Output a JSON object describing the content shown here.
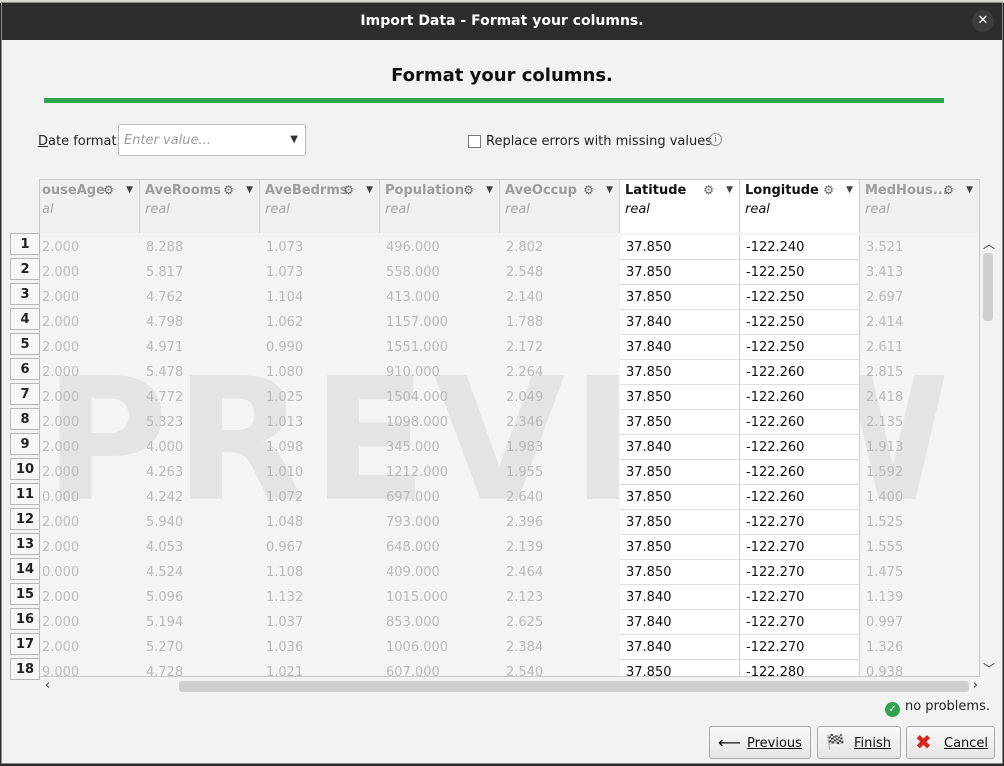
{
  "window": {
    "title": "Import Data - Format your columns.",
    "close_symbol": "✕"
  },
  "heading": "Format your columns.",
  "date_format": {
    "label_prefix": "D",
    "label_rest": "ate format",
    "placeholder": "Enter value..."
  },
  "replace_errors_label": "Replace errors with missing values",
  "watermark": "PREVIEW",
  "columns": [
    {
      "name": "ouseAge",
      "type": "al",
      "active": false
    },
    {
      "name": "AveRooms",
      "type": "real",
      "active": false
    },
    {
      "name": "AveBedrms",
      "type": "real",
      "active": false
    },
    {
      "name": "Population",
      "type": "real",
      "active": false
    },
    {
      "name": "AveOccup",
      "type": "real",
      "active": false
    },
    {
      "name": "Latitude",
      "type": "real",
      "active": true
    },
    {
      "name": "Longitude",
      "type": "real",
      "active": true
    },
    {
      "name": "MedHous...",
      "type": "real",
      "active": false
    }
  ],
  "rows": [
    {
      "n": "1",
      "c": [
        "2.000",
        "8.288",
        "1.073",
        "496.000",
        "2.802",
        "37.850",
        "-122.240",
        "3.521"
      ]
    },
    {
      "n": "2",
      "c": [
        "2.000",
        "5.817",
        "1.073",
        "558.000",
        "2.548",
        "37.850",
        "-122.250",
        "3.413"
      ]
    },
    {
      "n": "3",
      "c": [
        "2.000",
        "4.762",
        "1.104",
        "413.000",
        "2.140",
        "37.850",
        "-122.250",
        "2.697"
      ]
    },
    {
      "n": "4",
      "c": [
        "2.000",
        "4.798",
        "1.062",
        "1157.000",
        "1.788",
        "37.840",
        "-122.250",
        "2.414"
      ]
    },
    {
      "n": "5",
      "c": [
        "2.000",
        "4.971",
        "0.990",
        "1551.000",
        "2.172",
        "37.840",
        "-122.250",
        "2.611"
      ]
    },
    {
      "n": "6",
      "c": [
        "2.000",
        "5.478",
        "1.080",
        "910.000",
        "2.264",
        "37.850",
        "-122.260",
        "2.815"
      ]
    },
    {
      "n": "7",
      "c": [
        "2.000",
        "4.772",
        "1.025",
        "1504.000",
        "2.049",
        "37.850",
        "-122.260",
        "2.418"
      ]
    },
    {
      "n": "8",
      "c": [
        "2.000",
        "5.323",
        "1.013",
        "1098.000",
        "2.346",
        "37.850",
        "-122.260",
        "2.135"
      ]
    },
    {
      "n": "9",
      "c": [
        "2.000",
        "4.000",
        "1.098",
        "345.000",
        "1.983",
        "37.840",
        "-122.260",
        "1.913"
      ]
    },
    {
      "n": "10",
      "c": [
        "2.000",
        "4.263",
        "1.010",
        "1212.000",
        "1.955",
        "37.850",
        "-122.260",
        "1.592"
      ]
    },
    {
      "n": "11",
      "c": [
        "0.000",
        "4.242",
        "1.072",
        "697.000",
        "2.640",
        "37.850",
        "-122.260",
        "1.400"
      ]
    },
    {
      "n": "12",
      "c": [
        "2.000",
        "5.940",
        "1.048",
        "793.000",
        "2.396",
        "37.850",
        "-122.270",
        "1.525"
      ]
    },
    {
      "n": "13",
      "c": [
        "2.000",
        "4.053",
        "0.967",
        "648.000",
        "2.139",
        "37.850",
        "-122.270",
        "1.555"
      ]
    },
    {
      "n": "14",
      "c": [
        "0.000",
        "4.524",
        "1.108",
        "409.000",
        "2.464",
        "37.850",
        "-122.270",
        "1.475"
      ]
    },
    {
      "n": "15",
      "c": [
        "2.000",
        "5.096",
        "1.132",
        "1015.000",
        "2.123",
        "37.840",
        "-122.270",
        "1.139"
      ]
    },
    {
      "n": "16",
      "c": [
        "2.000",
        "5.194",
        "1.037",
        "853.000",
        "2.625",
        "37.840",
        "-122.270",
        "0.997"
      ]
    },
    {
      "n": "17",
      "c": [
        "2.000",
        "5.270",
        "1.036",
        "1006.000",
        "2.384",
        "37.840",
        "-122.270",
        "1.326"
      ]
    },
    {
      "n": "18",
      "c": [
        "9.000",
        "4.728",
        "1.021",
        "607.000",
        "2.540",
        "37.850",
        "-122.280",
        "0.938"
      ]
    }
  ],
  "status": "no problems.",
  "buttons": {
    "previous": {
      "prefix": "",
      "rest": "Previous"
    },
    "finish": {
      "prefix": "",
      "rest": "Finish"
    },
    "cancel": {
      "prefix": "",
      "rest": "Cancel"
    }
  },
  "icons": {
    "close": "close-icon",
    "gear": "gear-icon",
    "dropdown": "chevron-down-icon",
    "info": "info-icon",
    "check": "check-circle-icon",
    "previous": "arrow-left-icon",
    "finish": "checkered-flag-icon",
    "cancel": "red-x-icon"
  },
  "colors": {
    "accent": "#2ea44f",
    "titlebar": "#2d2d2d",
    "cancel": "#d9261c"
  }
}
